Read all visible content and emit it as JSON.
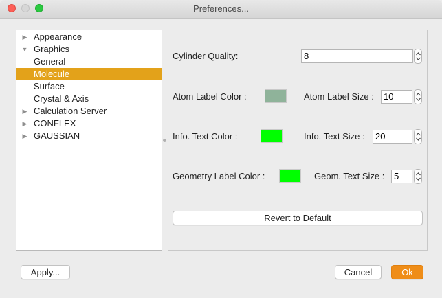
{
  "window": {
    "title": "Preferences..."
  },
  "tree": {
    "items": [
      {
        "label": "Appearance",
        "arrow": "▶"
      },
      {
        "label": "Graphics",
        "arrow": "▼"
      },
      {
        "label": "General",
        "arrow": ""
      },
      {
        "label": "Molecule",
        "arrow": ""
      },
      {
        "label": "Surface",
        "arrow": ""
      },
      {
        "label": "Crystal & Axis",
        "arrow": ""
      },
      {
        "label": "Calculation Server",
        "arrow": "▶"
      },
      {
        "label": "CONFLEX",
        "arrow": "▶"
      },
      {
        "label": "GAUSSIAN",
        "arrow": "▶"
      }
    ],
    "selected": "Molecule"
  },
  "settings": {
    "cylinder_quality_label": "Cylinder Quality:",
    "cylinder_quality_value": "8",
    "atom_label_color_label": "Atom Label Color :",
    "atom_label_color": "#8fb39a",
    "atom_label_size_label": "Atom Label Size :",
    "atom_label_size_value": "10",
    "info_text_color_label": "Info. Text Color :",
    "info_text_color": "#00ff00",
    "info_text_size_label": "Info. Text Size :",
    "info_text_size_value": "20",
    "geometry_label_color_label": "Geometry Label Color :",
    "geometry_label_color": "#00ff00",
    "geom_text_size_label": "Geom. Text Size :",
    "geom_text_size_value": "5",
    "revert_label": "Revert to Default"
  },
  "footer": {
    "apply_label": "Apply...",
    "cancel_label": "Cancel",
    "ok_label": "Ok"
  },
  "colors": {
    "selection": "#e3a21a",
    "ok_button": "#ef8d18"
  }
}
